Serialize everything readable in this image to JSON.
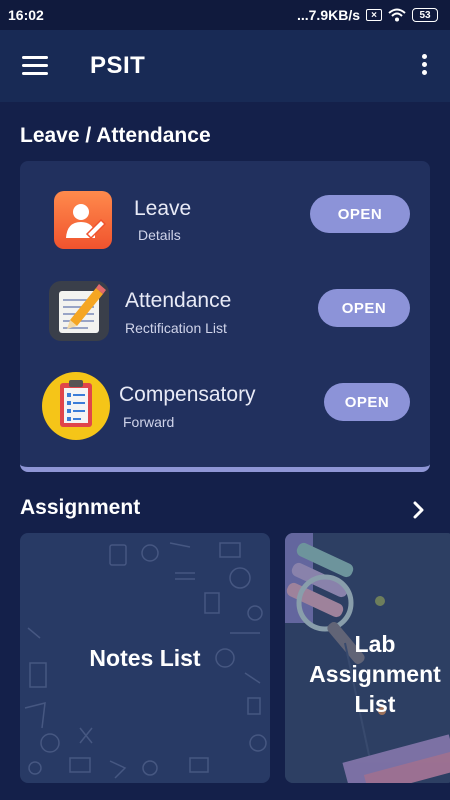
{
  "status_bar": {
    "time": "16:02",
    "network_speed": "...7.9KB/s",
    "sim_icon": "sim-x-icon",
    "wifi_icon": "wifi-icon",
    "battery": "53"
  },
  "app_bar": {
    "title": "PSIT",
    "menu_icon": "hamburger-menu-icon",
    "overflow_icon": "more-vertical-icon"
  },
  "leave_section": {
    "title": "Leave / Attendance",
    "items": [
      {
        "title": "Leave",
        "subtitle": "Details",
        "button": "OPEN",
        "icon": "leave-person-icon"
      },
      {
        "title": "Attendance",
        "subtitle": "Rectification List",
        "button": "OPEN",
        "icon": "notepad-pencil-icon"
      },
      {
        "title": "Compensatory",
        "subtitle": "Forward",
        "button": "OPEN",
        "icon": "clipboard-checklist-icon"
      }
    ]
  },
  "assignment_section": {
    "title": "Assignment",
    "chevron_icon": "chevron-right-icon",
    "tiles": [
      {
        "label": "Notes List"
      },
      {
        "label": "Lab Assignment List"
      }
    ]
  },
  "colors": {
    "background": "#14204a",
    "app_bar": "#182a55",
    "card": "#21305e",
    "button": "#8c93d8"
  }
}
